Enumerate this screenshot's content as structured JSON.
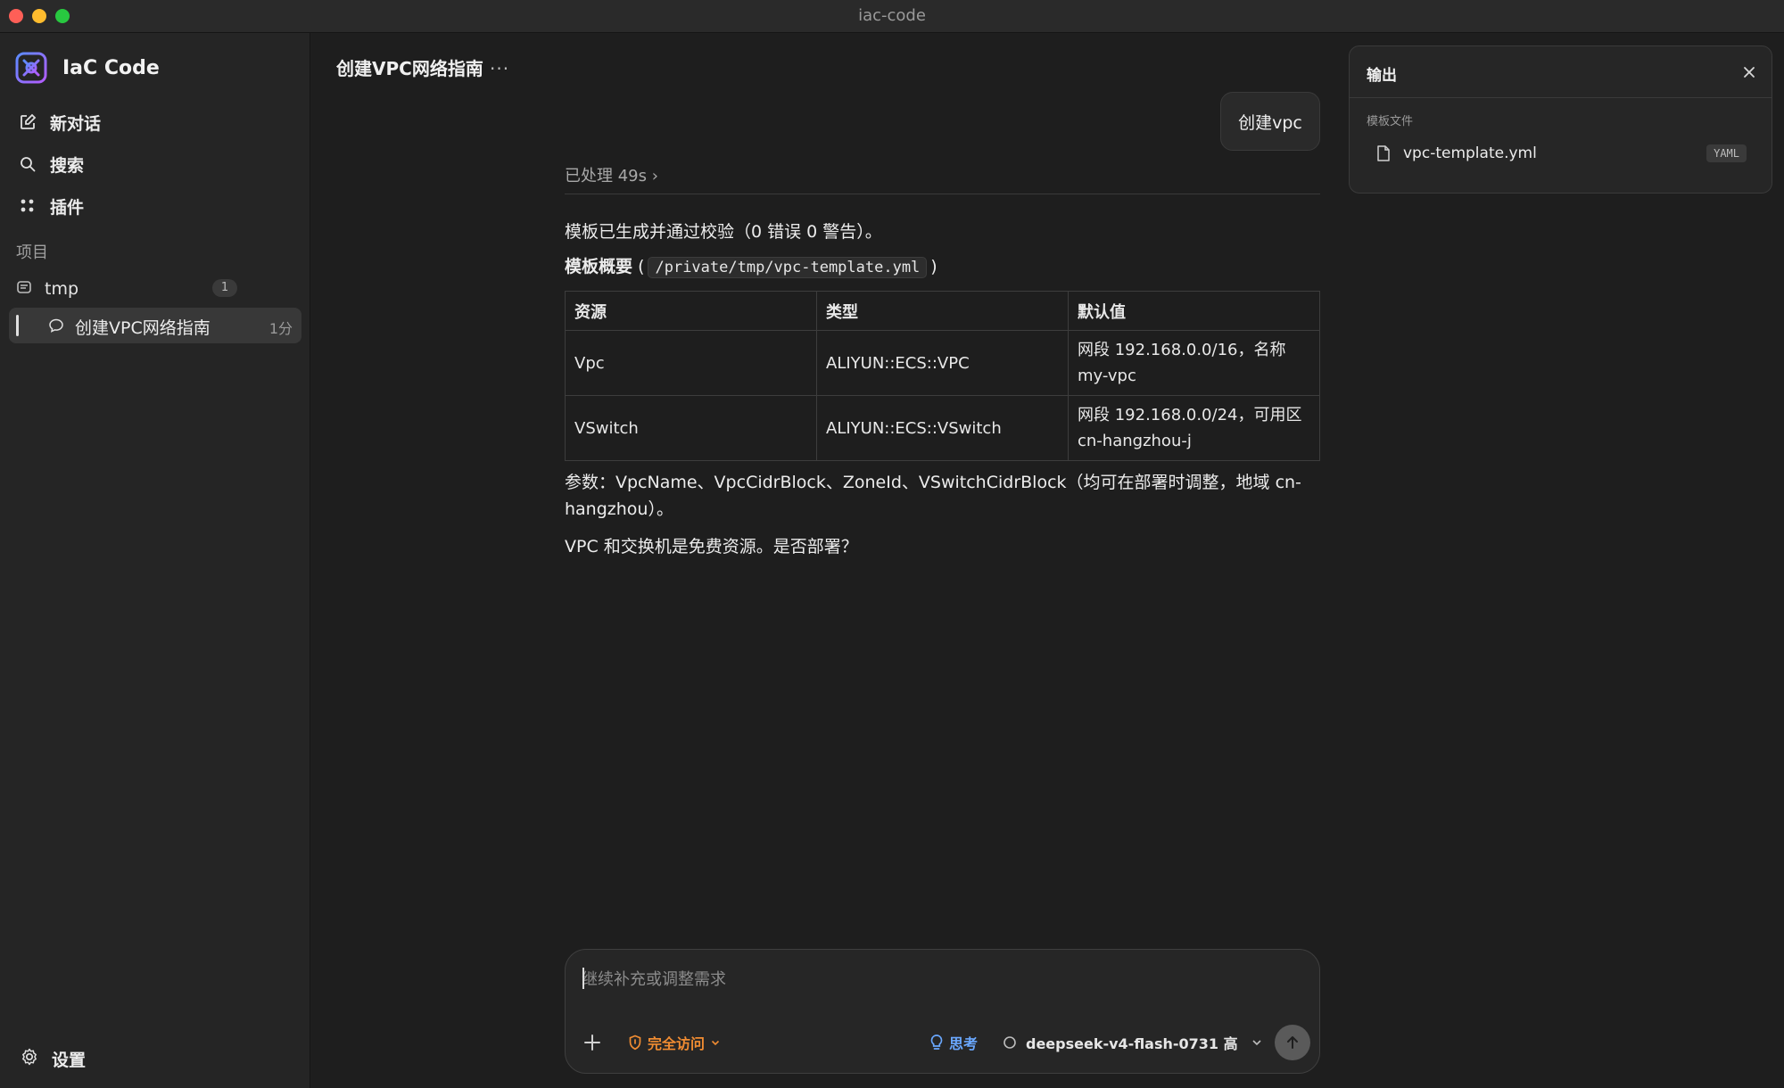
{
  "window": {
    "title": "iac-code"
  },
  "sidebar": {
    "brand": "IaC Code",
    "nav": [
      {
        "label": "新对话",
        "icon": "new-chat-icon"
      },
      {
        "label": "搜索",
        "icon": "search-icon"
      },
      {
        "label": "插件",
        "icon": "plugins-icon"
      }
    ],
    "section_label": "项目",
    "project": {
      "name": "tmp",
      "count": "1"
    },
    "conversation": {
      "title": "创建VPC网络指南",
      "time": "1分"
    },
    "settings_label": "设置"
  },
  "header": {
    "title": "创建VPC网络指南",
    "more": "..."
  },
  "chat": {
    "user_message": "创建vpc",
    "processed": "已处理 49s ›",
    "line1": "模板已生成并通过校验（0 错误 0 警告）。",
    "summary_label": "模板概要",
    "summary_open": "(",
    "summary_path": "/private/tmp/vpc-template.yml",
    "summary_close": ")",
    "table": {
      "headers": [
        "资源",
        "类型",
        "默认值"
      ],
      "rows": [
        [
          "Vpc",
          "ALIYUN::ECS::VPC",
          "网段 192.168.0.0/16，名称 my-vpc"
        ],
        [
          "VSwitch",
          "ALIYUN::ECS::VSwitch",
          "网段 192.168.0.0/24，可用区 cn-hangzhou-j"
        ]
      ]
    },
    "params": "参数：VpcName、VpcCidrBlock、ZoneId、VSwitchCidrBlock（均可在部署时调整，地域 cn-hangzhou）。",
    "question": "VPC 和交换机是免费资源。是否部署？"
  },
  "composer": {
    "placeholder": "继续补充或调整需求",
    "value": "",
    "access": "完全访问",
    "think": "思考",
    "model": "deepseek-v4-flash-0731 高"
  },
  "output_panel": {
    "title": "输出",
    "section": "模板文件",
    "file_name": "vpc-template.yml",
    "file_tag": "YAML"
  },
  "colors": {
    "access_accent": "#f08c32",
    "think_accent": "#6aa8ff",
    "traffic_red": "#fe5f57",
    "traffic_yellow": "#febc2e",
    "traffic_green": "#28c840"
  }
}
